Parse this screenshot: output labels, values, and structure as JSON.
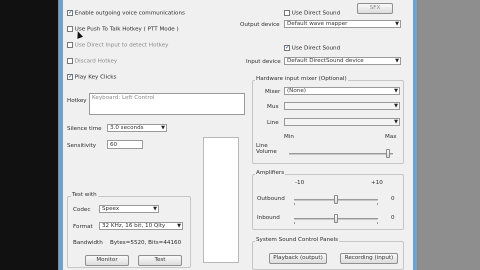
{
  "options": {
    "enable_outgoing": "Enable outgoing voice communications",
    "use_ptt": "Use Push To Talk Hotkey ( PTT Mode )",
    "use_direct_input": "Use Direct Input to detect Hotkey",
    "discard_hotkey": "Discard Hotkey",
    "play_key_clicks": "Play Key Clicks"
  },
  "hotkey": {
    "label": "Hotkey",
    "value": "Keyboard: Left Control"
  },
  "silence": {
    "label": "Silence time",
    "value": "3.0 seconds"
  },
  "sensitivity": {
    "label": "Sensitivity",
    "value": "60"
  },
  "test_with": {
    "title": "Test with",
    "codec_label": "Codec",
    "codec_value": "Speex",
    "format_label": "Format",
    "format_value": "32 KHz, 16 bit, 10 Qlty",
    "bandwidth_label": "Bandwidth",
    "bandwidth_value": "Bytes=5520, Bits=44160",
    "monitor_button": "Monitor",
    "test_button": "Test"
  },
  "top_right_button": "SFX",
  "output": {
    "use_direct_sound": "Use Direct Sound",
    "label": "Output device",
    "value": "Default wave mapper"
  },
  "input": {
    "use_direct_sound": "Use Direct Sound",
    "label": "Input device",
    "value": "Default DirectSound device"
  },
  "mixer": {
    "title": "Hardware input mixer (Optional)",
    "mixer_label": "Mixer",
    "mixer_value": "(None)",
    "mux_label": "Mux",
    "line_label": "Line",
    "min_label": "Min",
    "max_label": "Max",
    "line_volume_label": "Line\nVolume",
    "line_volume_level": 0.95
  },
  "amplifiers": {
    "title": "Amplifiers",
    "min_label": "-10",
    "max_label": "+10",
    "outbound_label": "Outbound",
    "outbound_value": "0",
    "outbound_level": 0.5,
    "inbound_label": "Inbound",
    "inbound_value": "0",
    "inbound_level": 0.5
  },
  "system_sound": {
    "title": "System Sound Control Panels",
    "playback_button": "Playback (output)",
    "recording_button": "Recording (input)"
  }
}
